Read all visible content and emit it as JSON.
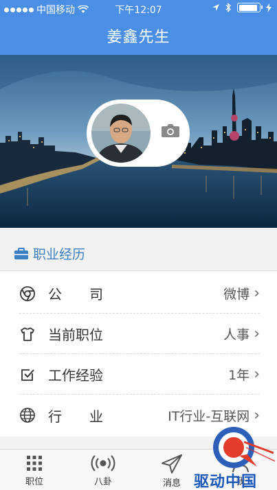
{
  "status_bar": {
    "carrier": "中国移动",
    "time": "下午12:07"
  },
  "navbar": {
    "title": "姜鑫先生"
  },
  "section": {
    "title": "职业经历"
  },
  "career": [
    {
      "icon": "chrome-icon",
      "label": "公　　司",
      "value": "微博"
    },
    {
      "icon": "shirt-icon",
      "label": "当前职位",
      "value": "人事"
    },
    {
      "icon": "checkbox-icon",
      "label": "工作经验",
      "value": "1年"
    },
    {
      "icon": "globe-icon",
      "label": "行　　业",
      "value": "IT行业-互联网"
    }
  ],
  "tabs": [
    {
      "icon": "grid-icon",
      "label": "职位"
    },
    {
      "icon": "broadcast-icon",
      "label": "八卦"
    },
    {
      "icon": "send-icon",
      "label": "消息"
    },
    {
      "icon": "user-icon",
      "label": "我"
    }
  ],
  "watermark": {
    "text": "驱动中国"
  },
  "colors": {
    "primary": "#4a8ee6",
    "section_title": "#3d7fc4"
  }
}
